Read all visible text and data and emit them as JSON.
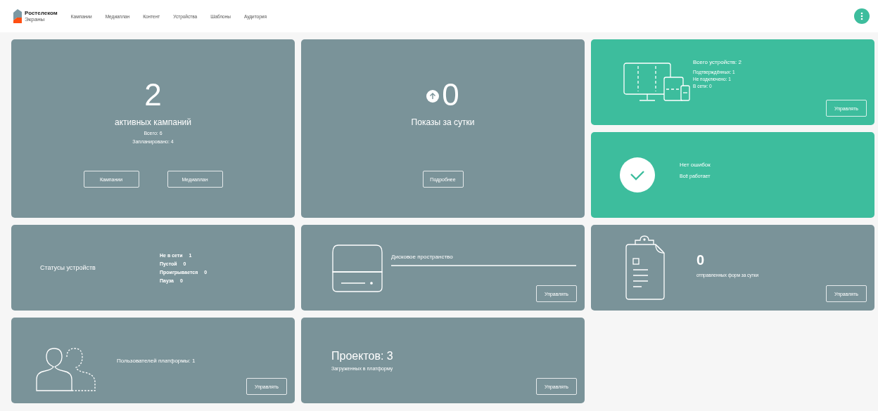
{
  "header": {
    "logo": {
      "name": "Ростелеком",
      "sub": "Экраны"
    },
    "nav": [
      {
        "label": "Кампании"
      },
      {
        "label": "Медиаплан"
      },
      {
        "label": "Контент"
      },
      {
        "label": "Устройства"
      },
      {
        "label": "Шаблоны"
      },
      {
        "label": "Аудитория"
      }
    ]
  },
  "cards": [
    {
      "kind": "campaigns",
      "color": "#7a9399",
      "value": "2",
      "title": "активных кампаний",
      "lines": [
        "Всего: 6",
        "Запланировано: 4"
      ],
      "buttons": [
        "Кампании",
        "Медиаплан"
      ]
    },
    {
      "kind": "impressions",
      "color": "#7a9399",
      "value": "0",
      "title": "Показы за сутки",
      "buttons": [
        "Подробнее"
      ]
    },
    {
      "kind": "devices",
      "color": "#3dbd9d",
      "title": "Всего устройств: 2",
      "lines": [
        "Подтверждённых: 1",
        "Не подключено: 1",
        "В сети: 0"
      ],
      "buttons": [
        "Управлять"
      ]
    },
    {
      "kind": "errors",
      "color": "#3dbd9d",
      "title": "Нет ошибок",
      "lines": [
        "Всё работает"
      ]
    },
    {
      "kind": "statuses",
      "color": "#7a9399",
      "title": "Статусы устройств",
      "statuses": [
        {
          "label": "Не в сети",
          "value": "1"
        },
        {
          "label": "Пустой",
          "value": "0"
        },
        {
          "label": "Проигрывается",
          "value": "0"
        },
        {
          "label": "Пауза",
          "value": "0"
        }
      ]
    },
    {
      "kind": "disk",
      "color": "#7a9399",
      "title": "Дисковое пространство",
      "buttons": [
        "Управлять"
      ]
    },
    {
      "kind": "forms",
      "color": "#7a9399",
      "value": "0",
      "title": "отправленных форм за сутки",
      "buttons": [
        "Управлять"
      ]
    },
    {
      "kind": "users",
      "color": "#7a9399",
      "title": "Пользователей платформы: 1",
      "buttons": [
        "Управлять"
      ]
    },
    {
      "kind": "projects",
      "color": "#7a9399",
      "title": "Проектов: 3",
      "lines": [
        "Загруженных в платформу"
      ],
      "buttons": [
        "Управлять"
      ]
    }
  ]
}
